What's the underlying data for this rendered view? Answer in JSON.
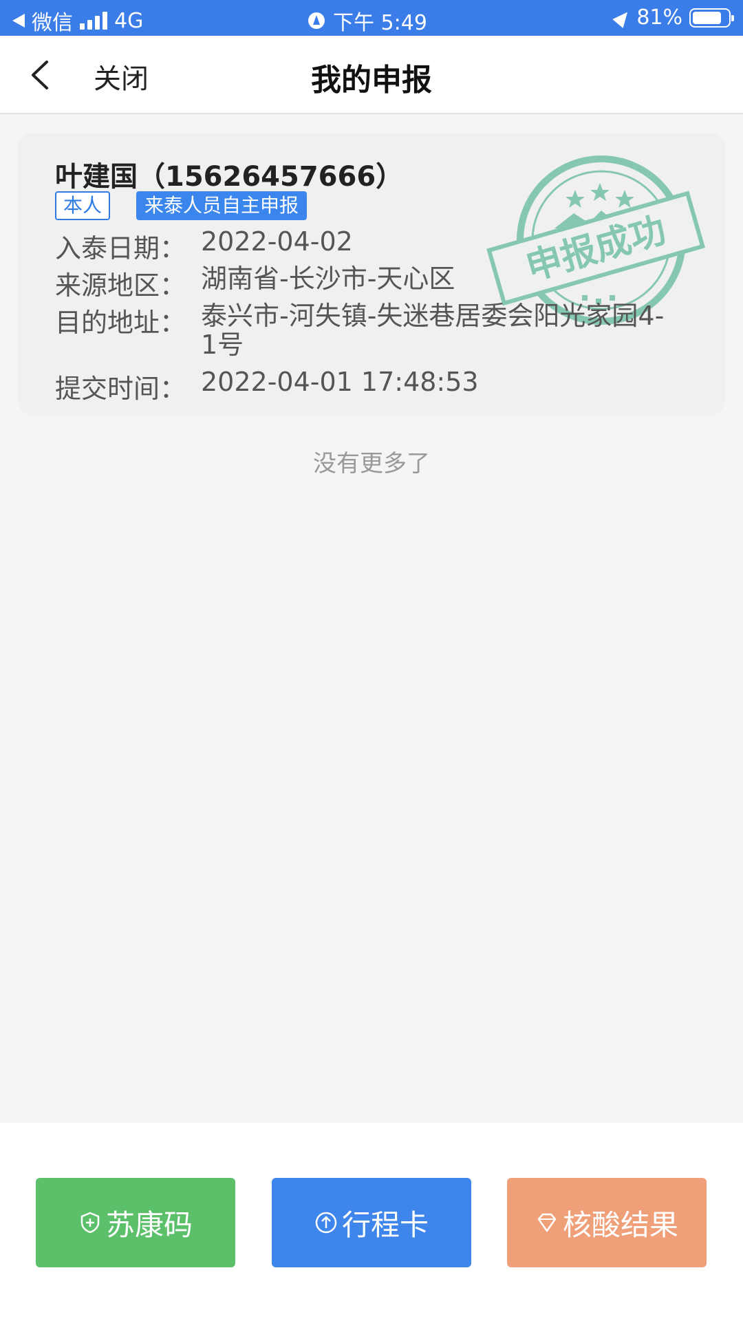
{
  "status_bar": {
    "back_app": "微信",
    "network": "4G",
    "time": "下午 5:49",
    "battery": "81%",
    "battery_level": 0.81
  },
  "nav": {
    "close_label": "关闭",
    "title": "我的申报"
  },
  "card": {
    "name_phone": "叶建国（15626457666）",
    "tag_self": "本人",
    "tag_type": "来泰人员自主申报",
    "rows": [
      {
        "label": "入泰日期：",
        "value": "2022-04-02"
      },
      {
        "label": "来源地区：",
        "value": "湖南省-长沙市-天心区"
      },
      {
        "label": "目的地址：",
        "value": "泰兴市-河失镇-失迷巷居委会阳光家园4-1号"
      },
      {
        "label": "提交时间：",
        "value": "2022-04-01 17:48:53"
      }
    ],
    "stamp_text": "申报成功",
    "stamp_color": "#2ea77a"
  },
  "list_end": "没有更多了",
  "buttons": {
    "sukang": "苏康码",
    "xingcheng": "行程卡",
    "hesuan": "核酸结果"
  },
  "colors": {
    "status_bar": "#3a7ce8",
    "sukang": "#5cbf6a",
    "xingcheng": "#3f86ec",
    "hesuan": "#f0a078"
  }
}
